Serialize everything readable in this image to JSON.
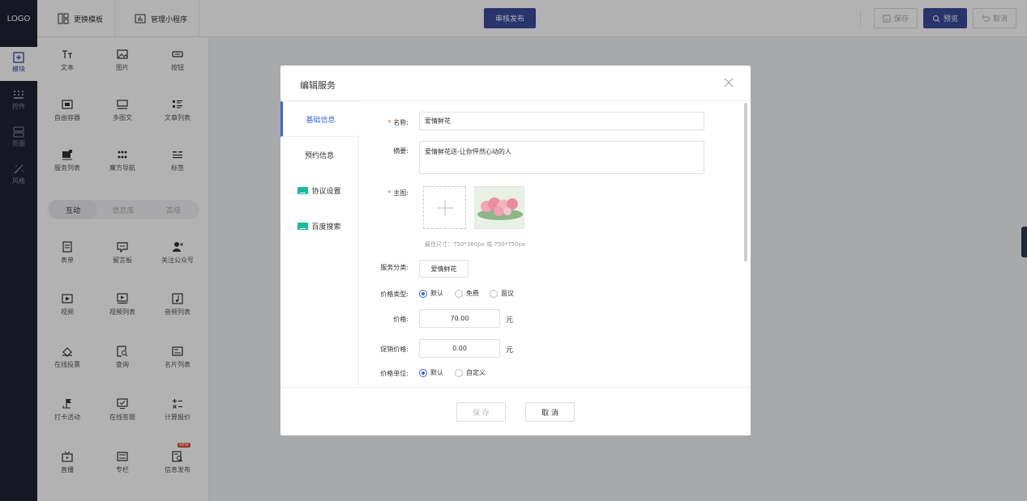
{
  "topbar": {
    "logo": "LOGO",
    "change_template": "更换模板",
    "manage_app": "管理小程序",
    "publish": "审核发布",
    "save": "保存",
    "preview": "预览",
    "cancel": "取消"
  },
  "leftnav": {
    "items": [
      {
        "label": "模块",
        "icon": "plus-square-icon"
      },
      {
        "label": "控件",
        "icon": "grid-dots-icon"
      },
      {
        "label": "页面",
        "icon": "pages-icon"
      },
      {
        "label": "风格",
        "icon": "magic-wand-icon"
      }
    ]
  },
  "panel": {
    "widgets_top": [
      "文本",
      "图片",
      "按钮",
      "自由容器",
      "多图文",
      "文章列表",
      "服务列表",
      "魔方导航",
      "标签"
    ],
    "segments": [
      "互动",
      "信息库",
      "高级"
    ],
    "widgets_bottom": [
      "表单",
      "留言板",
      "关注公众号",
      "视频",
      "视频列表",
      "音频列表",
      "在线投票",
      "查询",
      "名片列表",
      "打卡活动",
      "在线答题",
      "计算报价",
      "直播",
      "专栏",
      "信息发布"
    ],
    "new_badge": "NEW"
  },
  "modal": {
    "title": "编辑服务",
    "tabs": [
      "基础信息",
      "预约信息",
      "协议设置",
      "百度搜索"
    ],
    "fields": {
      "name_label": "名称:",
      "name_value": "爱情鲜花",
      "summary_label": "摘要:",
      "summary_value": "爱情鲜花送-让你怦然心动的人",
      "image_label": "主图:",
      "image_hint": "最佳尺寸：750*380px 或 750*750px",
      "category_label": "服务分类:",
      "category_value": "爱情鲜花",
      "price_type_label": "价格类型:",
      "price_type_options": [
        "默认",
        "免费",
        "面议"
      ],
      "price_label": "价格:",
      "price_value": "70.00",
      "promo_label": "促销价格:",
      "promo_value": "0.00",
      "currency": "元",
      "price_unit_label": "价格单位:",
      "price_unit_options": [
        "默认",
        "自定义"
      ]
    },
    "save": "保 存",
    "cancel": "取 消"
  }
}
